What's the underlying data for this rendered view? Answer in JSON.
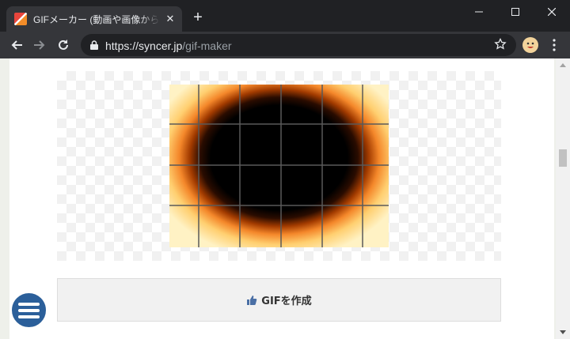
{
  "browser": {
    "tab": {
      "title": "GIFメーカー (動画や画像からアニメーションGIFを作成)",
      "close": "✕"
    },
    "new_tab": "+",
    "address": {
      "scheme": "https://",
      "host": "syncer.jp",
      "path": "/gif-maker"
    }
  },
  "page": {
    "create_button_label": "GIFを作成"
  },
  "icons": {
    "favicon": "syncer-favicon",
    "lock": "lock-icon",
    "star": "star-icon",
    "thumb": "thumbs-up-icon",
    "menu": "hamburger-menu-icon"
  },
  "colors": {
    "browser_frame": "#202124",
    "toolbar": "#35363a",
    "fab": "#2b5f9a"
  }
}
